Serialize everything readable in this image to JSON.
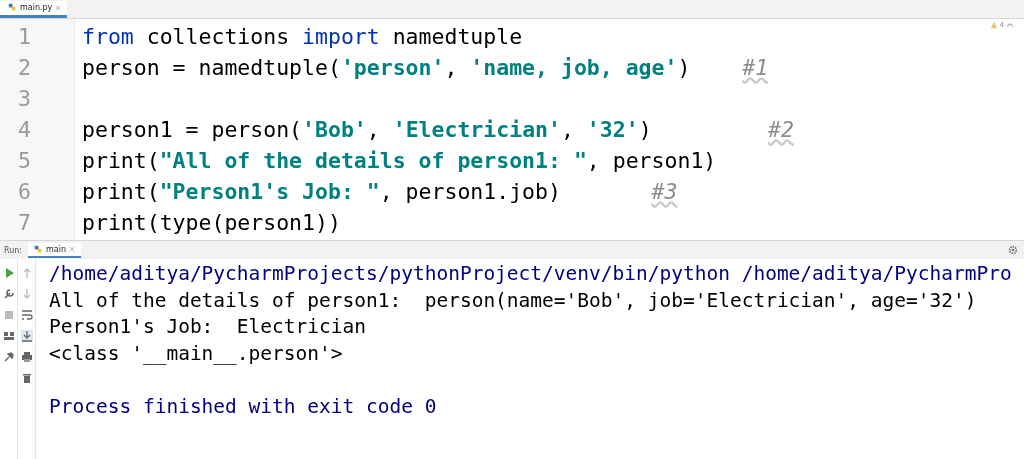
{
  "editor_tab": {
    "label": "main.py",
    "selected": true
  },
  "inspection": {
    "warnings": "4"
  },
  "code_lines": [
    {
      "number": "1",
      "tokens": [
        {
          "kind": "keyword",
          "text": "from"
        },
        {
          "kind": "plain",
          "text": " collections "
        },
        {
          "kind": "keyword",
          "text": "import"
        },
        {
          "kind": "plain",
          "text": " namedtuple"
        }
      ]
    },
    {
      "number": "2",
      "tokens": [
        {
          "kind": "plain",
          "text": "person = namedtuple("
        },
        {
          "kind": "string",
          "text": "'person'"
        },
        {
          "kind": "plain",
          "text": ", "
        },
        {
          "kind": "string",
          "text": "'name, job, age'"
        },
        {
          "kind": "plain",
          "text": ")    "
        },
        {
          "kind": "comment",
          "text": "#1"
        }
      ]
    },
    {
      "number": "3"
    },
    {
      "number": "4",
      "tokens": [
        {
          "kind": "plain",
          "text": "person1 = person("
        },
        {
          "kind": "string",
          "text": "'Bob'"
        },
        {
          "kind": "plain",
          "text": ", "
        },
        {
          "kind": "string",
          "text": "'Electrician'"
        },
        {
          "kind": "plain",
          "text": ", "
        },
        {
          "kind": "string",
          "text": "'32'"
        },
        {
          "kind": "plain",
          "text": ")         "
        },
        {
          "kind": "comment",
          "text": "#2"
        }
      ]
    },
    {
      "number": "5",
      "tokens": [
        {
          "kind": "plain",
          "text": "print("
        },
        {
          "kind": "string",
          "text": "\"All of the details of person1: \""
        },
        {
          "kind": "plain",
          "text": ", person1)"
        }
      ]
    },
    {
      "number": "6",
      "tokens": [
        {
          "kind": "plain",
          "text": "print("
        },
        {
          "kind": "string",
          "text": "\"Person1's Job: \""
        },
        {
          "kind": "plain",
          "text": ", person1.job)       "
        },
        {
          "kind": "comment",
          "text": "#3"
        }
      ]
    },
    {
      "number": "7",
      "tokens": [
        {
          "kind": "plain",
          "text": "print(type(person1))"
        }
      ]
    }
  ],
  "run_panel": {
    "label": "Run:",
    "tab": {
      "label": "main",
      "selected": true
    },
    "output": [
      {
        "kind": "command",
        "text": "/home/aditya/PycharmProjects/pythonProject/venv/bin/python /home/aditya/PycharmPro"
      },
      {
        "kind": "stdout",
        "text": "All of the details of person1:  person(name='Bob', job='Electrician', age='32')"
      },
      {
        "kind": "stdout",
        "text": "Person1's Job:  Electrician"
      },
      {
        "kind": "stdout",
        "text": "<class '__main__.person'>"
      },
      {
        "kind": "blank"
      },
      {
        "kind": "status",
        "text": "Process finished with exit code 0"
      }
    ]
  }
}
